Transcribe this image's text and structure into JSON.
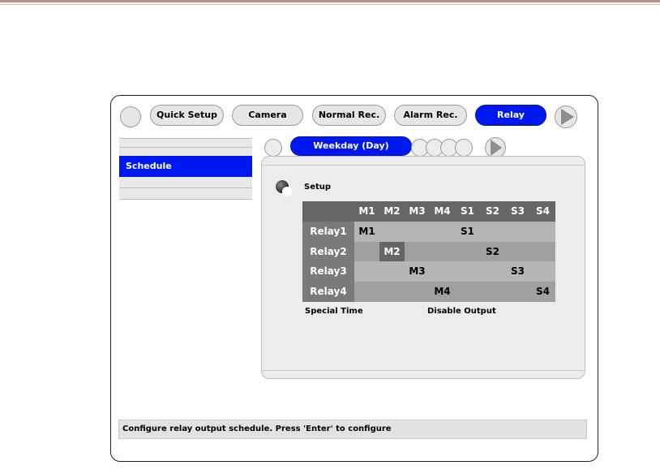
{
  "main_tabs": [
    {
      "label": "Quick Setup"
    },
    {
      "label": "Camera"
    },
    {
      "label": "Normal Rec."
    },
    {
      "label": "Alarm  Rec."
    },
    {
      "label": "Relay"
    }
  ],
  "active_main_tab": "Relay",
  "sidebar": {
    "items": [
      {
        "label": "Schedule"
      }
    ]
  },
  "sub_tabs": [
    {
      "label": "Weekday (Day)"
    }
  ],
  "section": {
    "title": "Setup"
  },
  "schedule": {
    "headers": [
      "",
      "M1",
      "M2",
      "M3",
      "M4",
      "S1",
      "S2",
      "S3",
      "S4"
    ],
    "rows": [
      {
        "label": "Relay1",
        "cells": [
          "M1",
          "",
          "",
          "",
          "S1",
          "",
          "",
          ""
        ]
      },
      {
        "label": "Relay2",
        "cells": [
          "",
          "M2",
          "",
          "",
          "",
          "S2",
          "",
          ""
        ]
      },
      {
        "label": "Relay3",
        "cells": [
          "",
          "",
          "M3",
          "",
          "",
          "",
          "S3",
          ""
        ]
      },
      {
        "label": "Relay4",
        "cells": [
          "",
          "",
          "",
          "M4",
          "",
          "",
          "",
          "S4"
        ]
      }
    ]
  },
  "legend": {
    "special_time": "Special Time",
    "disable_output": "Disable Output"
  },
  "status_bar": {
    "message": "Configure relay output schedule. Press 'Enter' to configure"
  },
  "colors": {
    "active": "#0018f0",
    "panel": "#ececec",
    "header": "#666666"
  }
}
